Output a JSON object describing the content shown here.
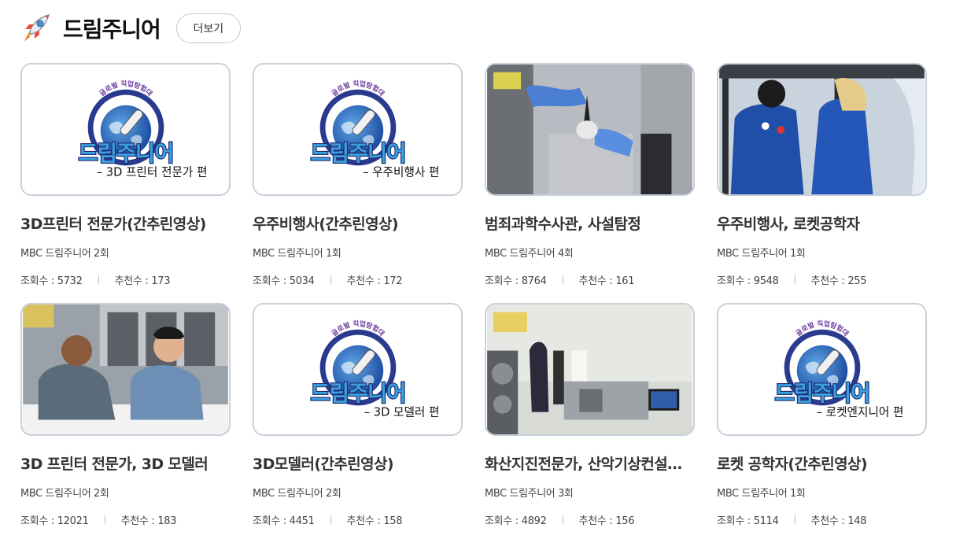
{
  "section": {
    "title": "드림주니어",
    "more_label": "더보기",
    "icon": "rocket-icon"
  },
  "logo": {
    "arc_text": "글로벌 직업탐험대",
    "brand_text": "드림주니어"
  },
  "cards": [
    {
      "thumb": "logo",
      "logo_caption": "– 3D 프린터 전문가 편",
      "title": "3D프린터 전문가(간추린영상)",
      "sub": "MBC 드림주니어 2회",
      "views": "조회수 : 5732",
      "likes": "추천수 : 173"
    },
    {
      "thumb": "logo",
      "logo_caption": "– 우주비행사 편",
      "title": "우주비행사(간추린영상)",
      "sub": "MBC 드림주니어 1회",
      "views": "조회수 : 5034",
      "likes": "추천수 : 172"
    },
    {
      "thumb": "lab",
      "title": "범죄과학수사관, 사설탐정",
      "sub": "MBC 드림주니어 4회",
      "views": "조회수 : 8764",
      "likes": "추천수 : 161"
    },
    {
      "thumb": "astronaut",
      "title": "우주비행사, 로켓공학자",
      "sub": "MBC 드림주니어 1회",
      "views": "조회수 : 9548",
      "likes": "추천수 : 255"
    },
    {
      "thumb": "men",
      "title": "3D 프린터 전문가, 3D 모델러",
      "sub": "MBC 드림주니어 2회",
      "views": "조회수 : 12021",
      "likes": "추천수 : 183"
    },
    {
      "thumb": "logo",
      "logo_caption": "– 3D 모델러 편",
      "title": "3D모델러(간추린영상)",
      "sub": "MBC 드림주니어 2회",
      "views": "조회수 : 4451",
      "likes": "추천수 : 158"
    },
    {
      "thumb": "volcano",
      "title": "화산지진전문가, 산악기상컨설…",
      "sub": "MBC 드림주니어 3회",
      "views": "조회수 : 4892",
      "likes": "추천수 : 156"
    },
    {
      "thumb": "logo",
      "logo_caption": "– 로켓엔지니어 편",
      "title": "로켓 공학자(간추린영상)",
      "sub": "MBC 드림주니어 1회",
      "views": "조회수 : 5114",
      "likes": "추천수 : 148"
    }
  ]
}
